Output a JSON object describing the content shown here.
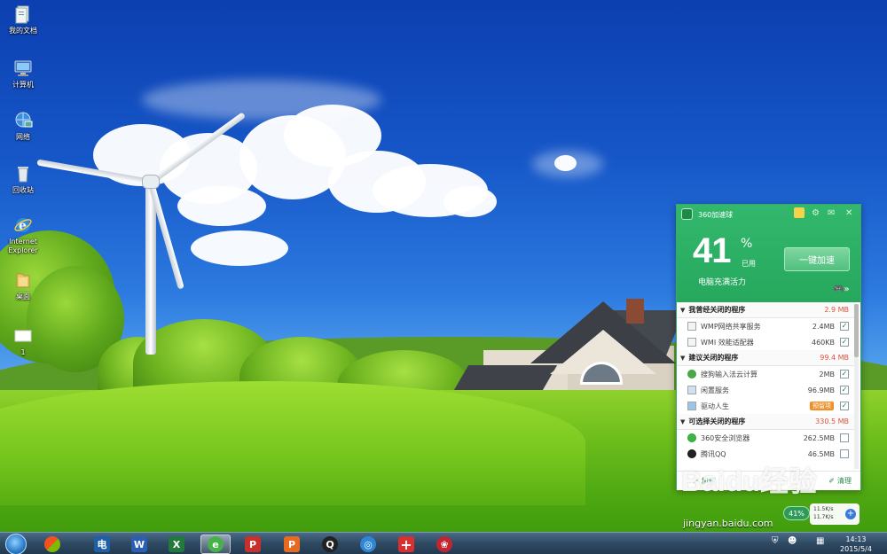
{
  "desktop": {
    "icons": [
      {
        "label": "我的文档",
        "icon": "documents-icon"
      },
      {
        "label": "计算机",
        "icon": "computer-icon"
      },
      {
        "label": "网络",
        "icon": "network-icon"
      },
      {
        "label": "回收站",
        "icon": "recycle-bin-icon"
      },
      {
        "label": "Internet Explorer",
        "icon": "ie-icon"
      },
      {
        "label": "桌面",
        "icon": "folder-icon"
      },
      {
        "label": "1",
        "icon": "file-icon"
      }
    ]
  },
  "accelerator": {
    "title": "360加速球",
    "percent": "41",
    "percent_sign": "%",
    "used_label": "已用",
    "status": "电脑充满活力",
    "boost_button": "一键加速",
    "sections": [
      {
        "title": "我曾经关闭的程序",
        "size": "2.9 MB",
        "items": [
          {
            "name": "WMP网络共享服务",
            "size": "2.4MB",
            "checked": true
          },
          {
            "name": "WMI 效能适配器",
            "size": "460KB",
            "checked": true
          }
        ]
      },
      {
        "title": "建议关闭的程序",
        "size": "99.4 MB",
        "items": [
          {
            "name": "搜狗输入法云计算",
            "size": "2MB",
            "checked": true
          },
          {
            "name": "闲置服务",
            "size": "96.9MB",
            "checked": true
          },
          {
            "name": "驱动人生",
            "tag": "预留项",
            "checked": true
          }
        ]
      },
      {
        "title": "可选择关闭的程序",
        "size": "330.5 MB",
        "items": [
          {
            "name": "360安全浏览器",
            "size": "262.5MB",
            "checked": false
          },
          {
            "name": "腾讯QQ",
            "size": "46.5MB",
            "checked": false
          }
        ]
      }
    ],
    "footer": {
      "accelerate": "加速",
      "clean": "清理"
    },
    "mini_ball_percent": "41%",
    "upload_speed": "11.5K/s",
    "download_speed": "11.7K/s"
  },
  "watermark": {
    "brand": "Baidu经验",
    "url": "jingyan.baidu.com"
  },
  "taskbar": {
    "time": "14:13",
    "date": "2015/5/4",
    "apps": [
      {
        "name": "windows-explorer-icon",
        "glyph": ""
      },
      {
        "name": "dictionary-icon",
        "glyph": "电"
      },
      {
        "name": "word-icon",
        "glyph": "W"
      },
      {
        "name": "excel-icon",
        "glyph": "X"
      },
      {
        "name": "360-browser-icon",
        "glyph": "e"
      },
      {
        "name": "pdf-reader-icon",
        "glyph": "P"
      },
      {
        "name": "pdf-icon",
        "glyph": "P"
      },
      {
        "name": "qq-icon",
        "glyph": "Q"
      },
      {
        "name": "weibo-icon",
        "glyph": "◎"
      },
      {
        "name": "360-rescue-icon",
        "glyph": "+"
      },
      {
        "name": "app-icon",
        "glyph": "❀"
      }
    ]
  }
}
